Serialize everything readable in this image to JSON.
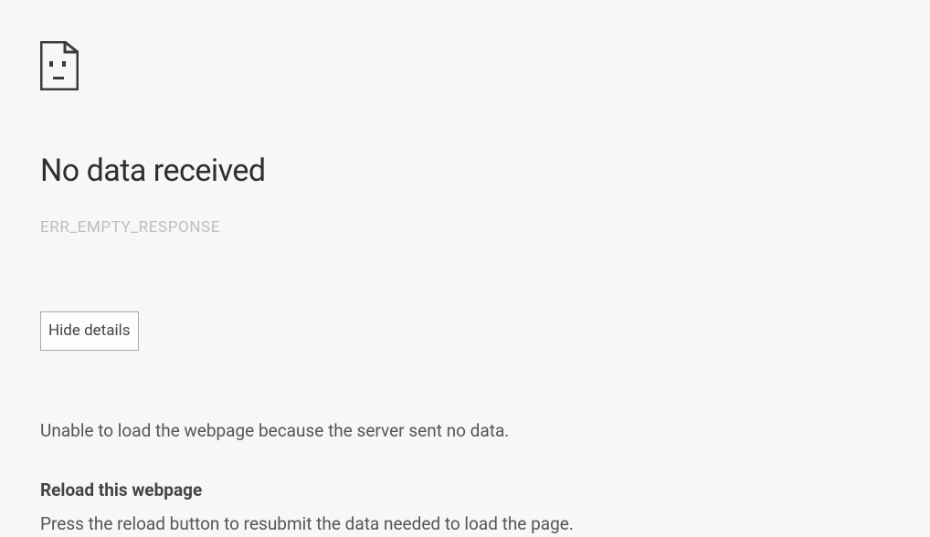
{
  "error": {
    "heading": "No data received",
    "code": "ERR_EMPTY_RESPONSE",
    "hide_details_label": "Hide details",
    "details_text": "Unable to load the webpage because the server sent no data.",
    "suggestion_title": "Reload this webpage",
    "suggestion_body": "Press the reload button to resubmit the data needed to load the page."
  }
}
